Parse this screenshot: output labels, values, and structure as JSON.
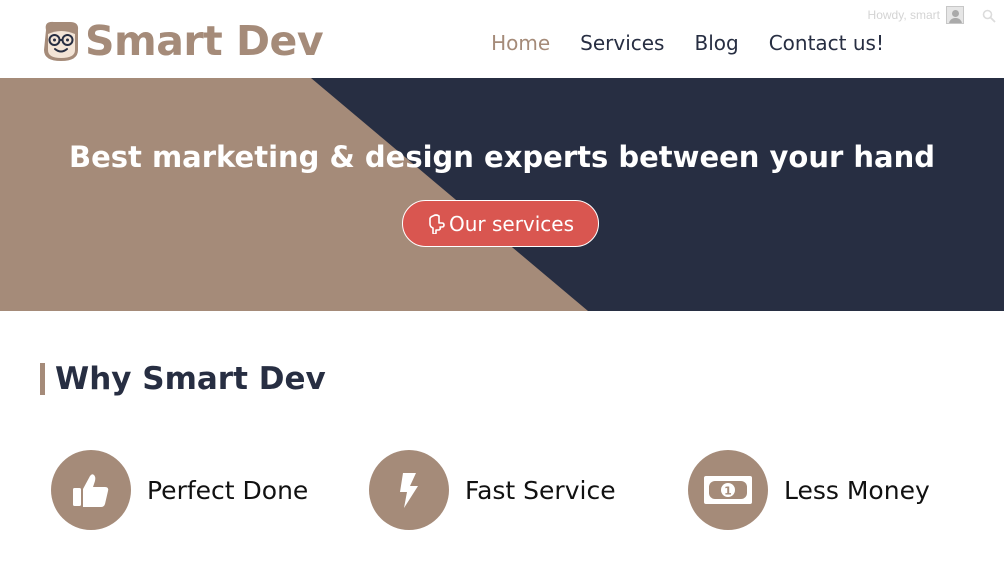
{
  "brand": {
    "name": "Smart Dev",
    "color": "#a58b79"
  },
  "topbar": {
    "greeting": "Howdy, smart"
  },
  "nav": {
    "items": [
      {
        "label": "Home",
        "active": true
      },
      {
        "label": "Services",
        "active": false
      },
      {
        "label": "Blog",
        "active": false
      },
      {
        "label": "Contact us!",
        "active": false
      }
    ]
  },
  "hero": {
    "title": "Best marketing & design experts between your hand",
    "button_label": "Our services",
    "button_icon": "hand-pointing-icon",
    "colors": {
      "dark": "#272e42",
      "tan": "#a58b79",
      "button": "#d95650"
    }
  },
  "why": {
    "title": "Why Smart Dev"
  },
  "features": [
    {
      "label": "Perfect Done",
      "icon": "thumbs-up-icon"
    },
    {
      "label": "Fast Service",
      "icon": "lightning-icon"
    },
    {
      "label": "Less Money",
      "icon": "money-bill-icon"
    }
  ]
}
